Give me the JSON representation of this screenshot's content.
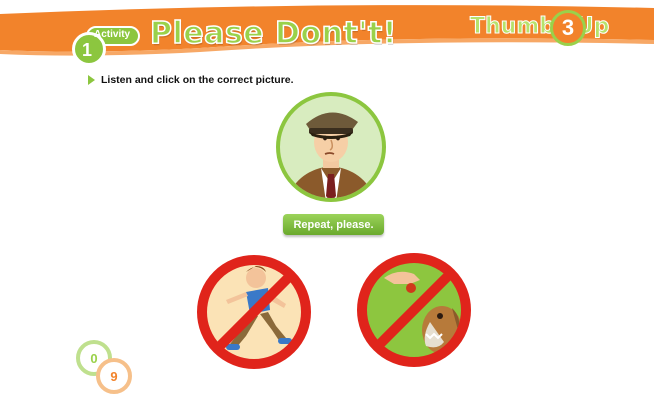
{
  "header": {
    "activity_label": "Activity",
    "activity_number": "1",
    "title": "Please Dont't!",
    "brand_name": "Thumbs Up",
    "brand_number": "3"
  },
  "instruction": {
    "text": "Listen and click on the correct picture."
  },
  "repeat_button": {
    "label": "Repeat, please."
  },
  "choices": [
    {
      "name": "running-boy-prohibited"
    },
    {
      "name": "feeding-dog-prohibited"
    }
  ],
  "counter": {
    "tens": "0",
    "units": "9"
  },
  "colors": {
    "header_orange": "#f2832b",
    "accent_green": "#8cc63f",
    "prohibition_red": "#e0241b"
  }
}
